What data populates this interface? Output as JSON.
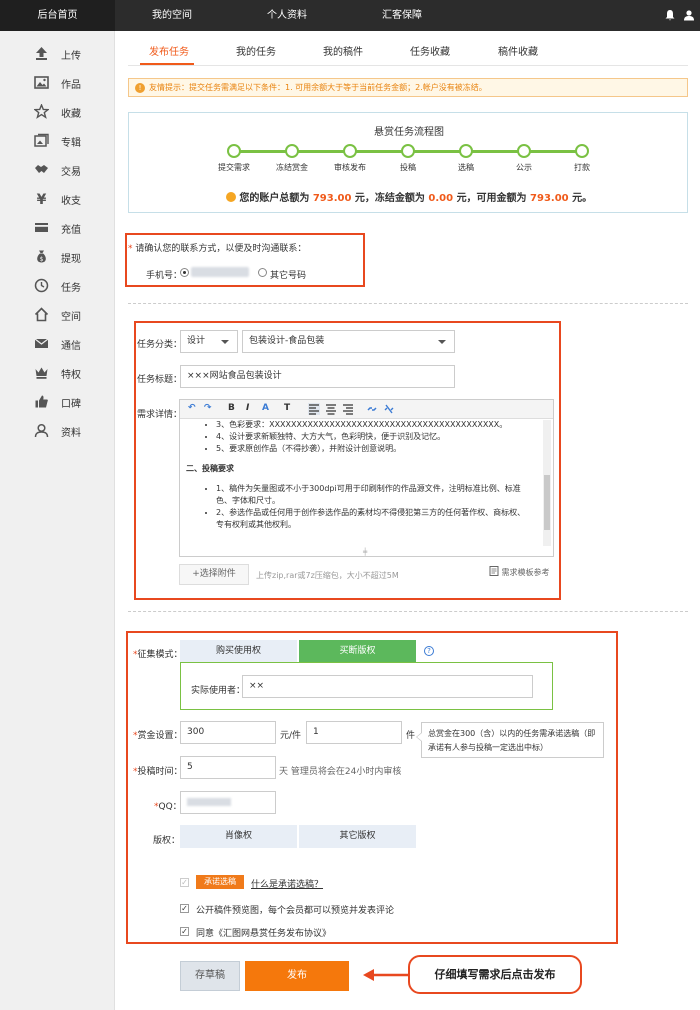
{
  "topbar": {
    "home": "后台首页",
    "nav": [
      "我的空间",
      "个人资料",
      "汇客保障"
    ],
    "icons": [
      "bell-icon",
      "user-icon"
    ]
  },
  "sidebar": {
    "items": [
      {
        "label": "上传",
        "icon": "upload-icon"
      },
      {
        "label": "作品",
        "icon": "image-icon"
      },
      {
        "label": "收藏",
        "icon": "star-icon"
      },
      {
        "label": "专辑",
        "icon": "album-icon"
      },
      {
        "label": "交易",
        "icon": "handshake-icon"
      },
      {
        "label": "收支",
        "icon": "yen-icon"
      },
      {
        "label": "充值",
        "icon": "card-icon"
      },
      {
        "label": "提现",
        "icon": "moneybag-icon"
      },
      {
        "label": "任务",
        "icon": "clock-icon"
      },
      {
        "label": "空间",
        "icon": "home-icon"
      },
      {
        "label": "通信",
        "icon": "mail-icon"
      },
      {
        "label": "特权",
        "icon": "crown-icon"
      },
      {
        "label": "口碑",
        "icon": "thumb-icon"
      },
      {
        "label": "资料",
        "icon": "person-icon"
      }
    ]
  },
  "tabs": [
    "发布任务",
    "我的任务",
    "我的稿件",
    "任务收藏",
    "稿件收藏"
  ],
  "notice": "友情提示：提交任务需满足以下条件：1. 可用余额大于等于当前任务金额；2.帐户没有被冻结。",
  "flow": {
    "title": "悬赏任务流程图",
    "steps": [
      "提交需求",
      "冻结赏金",
      "审核发布",
      "投稿",
      "选稿",
      "公示",
      "打款"
    ]
  },
  "balance": {
    "prefix": "您的账户总额为",
    "total": "793.00",
    "mid1": "元，冻结金额为",
    "frozen": "0.00",
    "mid2": "元，可用金额为",
    "available": "793.00",
    "suffix": "元。"
  },
  "contact": {
    "title": "请确认您的联系方式，以便及时沟通联系：",
    "phone_label": "手机号：",
    "other_label": "其它号码"
  },
  "task": {
    "category_label": "任务分类：",
    "category": "设计",
    "subcategory": "包装设计-食品包装",
    "title_label": "任务标题：",
    "title_value": "×××网站食品包装设计",
    "detail_label": "需求详情：",
    "toolbar": [
      "↶",
      "↷",
      "B",
      "I",
      "A",
      "T"
    ],
    "content": {
      "items1": [
        "3、色彩要求：XXXXXXXXXXXXXXXXXXXXXXXXXXXXXXXXXXXXXXXXXX。",
        "4、设计要求新颖独特、大方大气，色彩明快，便于识别及记忆。",
        "5、要求原创作品（不得抄袭），并附设计创意说明。"
      ],
      "heading": "二、投稿要求",
      "items2": [
        "1、稿件为矢量图或不小于300dpi可用于印刷制作的作品源文件，注明标准比例、标准色、字体和尺寸。",
        "2、参选作品或任何用于创作参选作品的素材均不得侵犯第三方的任何著作权、商标权、专有权利或其他权利。"
      ]
    },
    "upload_btn": "+选择附件",
    "upload_note": "上传zip,rar或7z压缩包，大小不超过5M",
    "template_link": "需求模板参考"
  },
  "collect": {
    "mode_label": "征集模式：",
    "mode_options": [
      "购买使用权",
      "买断版权"
    ],
    "actual_user_label": "实际使用者：",
    "actual_user_value": "××",
    "reward_label": "赏金设置：",
    "reward_value": "300",
    "reward_unit": "元/件",
    "count_value": "1",
    "count_unit": "件",
    "tip": "总赏金在300（含）以内的任务需承诺选稿（即承诺有人参与投稿一定选出中标）",
    "days_label": "投稿时间：",
    "days_value": "5",
    "days_note": "天 管理员将会在24小时内审核",
    "qq_label": "QQ：",
    "rights_label": "版权：",
    "rights_options": [
      "肖像权",
      "其它版权"
    ],
    "promise_tag": "承诺选稿",
    "promise_link": "什么是承诺选稿？",
    "public_label": "公开稿件预览图，每个会员都可以预览并发表评论",
    "agree_label": "同意《汇图网悬赏任务发布协议》"
  },
  "actions": {
    "draft": "存草稿",
    "publish": "发布"
  },
  "callout": "仔细填写需求后点击发布",
  "colors": {
    "accent": "#f05a1a",
    "publish": "#f5780c",
    "green": "#7ac143",
    "highlight": "#e8481f"
  }
}
